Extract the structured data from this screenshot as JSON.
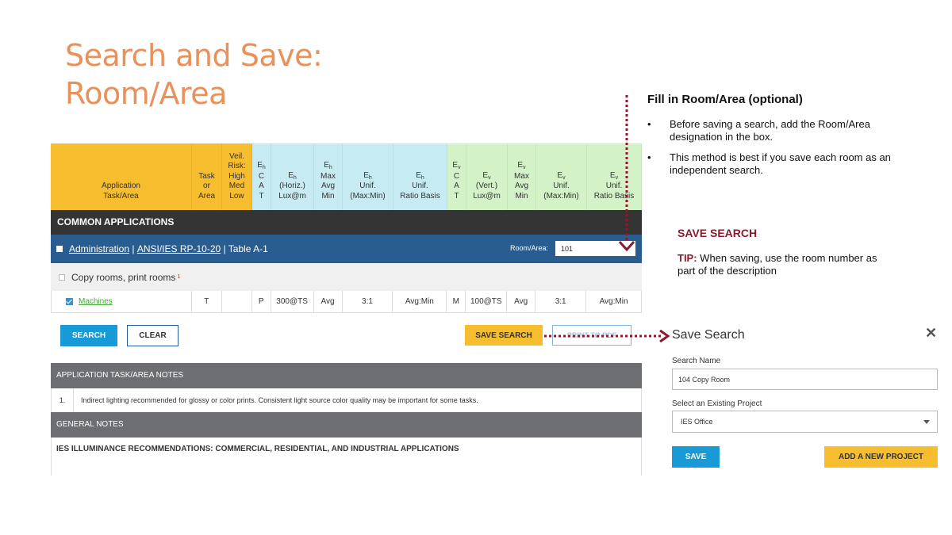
{
  "slide": {
    "title_line1": "Search and Save:",
    "title_line2": "Room/Area"
  },
  "table": {
    "headers": [
      {
        "lines": [
          "Application",
          "Task/Area"
        ],
        "color": "yellow"
      },
      {
        "lines": [
          "Task",
          "or",
          "Area"
        ],
        "color": "yellow"
      },
      {
        "lines": [
          "Veil.",
          "Risk:",
          "High",
          "Med",
          "Low"
        ],
        "color": "yellow"
      },
      {
        "lines": [
          "E_h",
          "C",
          "A",
          "T"
        ],
        "color": "blue"
      },
      {
        "lines": [
          "E_h",
          "(Horiz.)",
          "Lux@m"
        ],
        "color": "blue"
      },
      {
        "lines": [
          "E_h",
          "Max",
          "Avg",
          "Min"
        ],
        "color": "blue"
      },
      {
        "lines": [
          "E_h",
          "Unif.",
          "(Max:Min)"
        ],
        "color": "blue"
      },
      {
        "lines": [
          "E_h",
          "Unif.",
          "Ratio Basis"
        ],
        "color": "blue"
      },
      {
        "lines": [
          "E_v",
          "C",
          "A",
          "T"
        ],
        "color": "green"
      },
      {
        "lines": [
          "E_v",
          "(Vert.)",
          "Lux@m"
        ],
        "color": "green"
      },
      {
        "lines": [
          "E_v",
          "Max",
          "Avg",
          "Min"
        ],
        "color": "green"
      },
      {
        "lines": [
          "E_v",
          "Unif.",
          "(Max:Min)"
        ],
        "color": "green"
      },
      {
        "lines": [
          "E_v",
          "Unif.",
          "Ratio Basis"
        ],
        "color": "green"
      }
    ],
    "common_label": "COMMON APPLICATIONS",
    "admin": {
      "link1": "Administration",
      "sep1": " | ",
      "link2": "ANSI/IES RP-10-20",
      "rest": " | Table A-1"
    },
    "room_label": "Room/Area:",
    "room_value": "101",
    "copy_row": {
      "label": "Copy rooms, print rooms",
      "sup": "1"
    },
    "machines_row": [
      "Machines",
      "T",
      "",
      "P",
      "300@TS",
      "Avg",
      "3:1",
      "Avg:Min",
      "M",
      "100@TS",
      "Avg",
      "3:1",
      "Avg:Min"
    ]
  },
  "buttons": {
    "search": "SEARCH",
    "clear": "CLEAR",
    "save_search": "SAVE SEARCH",
    "print": "PRINT TO PDF"
  },
  "notes": {
    "header": "APPLICATION TASK/AREA NOTES",
    "items": [
      {
        "num": "1.",
        "text": "Indirect lighting recommended for glossy or color prints. Consistent light source color quality may be important for some tasks."
      }
    ],
    "general_header": "GENERAL NOTES",
    "general_text": "IES ILLUMINANCE RECOMMENDATIONS: COMMERCIAL, RESIDENTIAL, AND INDUSTRIAL APPLICATIONS"
  },
  "callout": {
    "title": "Fill in Room/Area (optional)",
    "bullets": [
      "Before saving a search, add the Room/Area designation in the box.",
      "This method is best if you save each room as an independent search."
    ]
  },
  "tip": {
    "title": "SAVE SEARCH",
    "label": "TIP:",
    "text": " When saving, use the room number as part of the description"
  },
  "panel": {
    "title": "Save Search",
    "close": "✕",
    "name_label": "Search Name",
    "name_value": "104 Copy Room",
    "project_label": "Select an Existing Project",
    "project_value": "IES Office",
    "save_button": "SAVE",
    "add_button": "ADD A NEW PROJECT"
  },
  "colors": {
    "title": "#e8915a",
    "accent_dark_red": "#8b1a2e",
    "blue": "#189ad7",
    "yellow": "#f6bd2e",
    "navy": "#2a5d8f"
  }
}
